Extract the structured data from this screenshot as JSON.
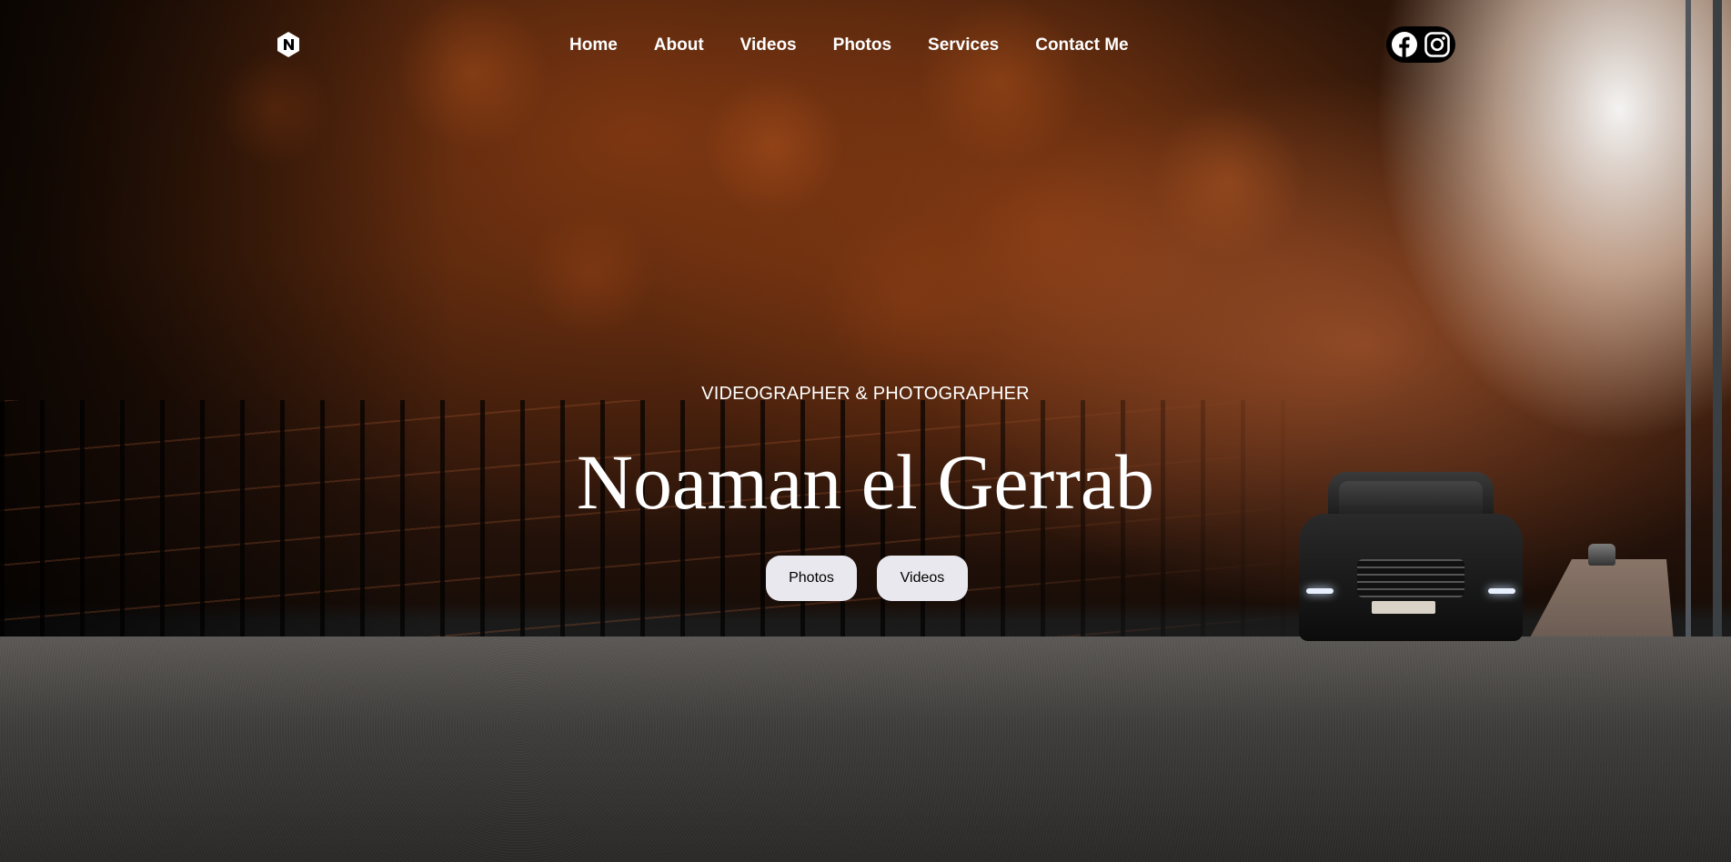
{
  "nav": {
    "logo_icon": "n-hexagon-logo-icon",
    "items": [
      {
        "label": "Home"
      },
      {
        "label": "About"
      },
      {
        "label": "Videos"
      },
      {
        "label": "Photos"
      },
      {
        "label": "Services"
      },
      {
        "label": "Contact Me"
      }
    ],
    "social": {
      "icons": [
        "facebook-icon",
        "instagram-icon"
      ],
      "background": "#000000"
    }
  },
  "hero": {
    "subtitle": "VIDEOGRAPHER & PHOTOGRAPHER",
    "title": "Noaman el Gerrab",
    "buttons": [
      {
        "label": "Photos"
      },
      {
        "label": "Videos"
      }
    ],
    "button_color": "#e9e8ee",
    "text_color": "#ffffff"
  }
}
